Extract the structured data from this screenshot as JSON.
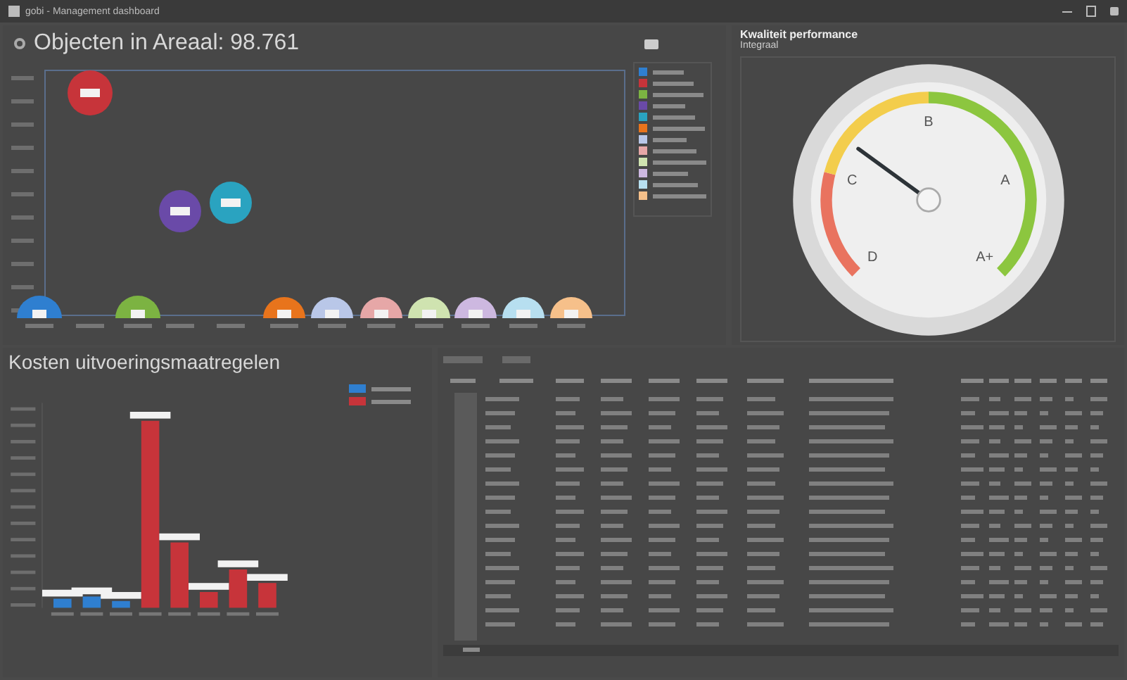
{
  "window": {
    "title": "gobi - Management dashboard"
  },
  "objects_panel": {
    "title": "Objecten in Areaal: 98.761",
    "legend": [
      {
        "color": "#2f7fd0"
      },
      {
        "color": "#c7343a"
      },
      {
        "color": "#7cb342"
      },
      {
        "color": "#6a4aa8"
      },
      {
        "color": "#2aa3c0"
      },
      {
        "color": "#e8741c"
      },
      {
        "color": "#b9c7e8"
      },
      {
        "color": "#e6a7a7"
      },
      {
        "color": "#cfe3b0"
      },
      {
        "color": "#cdb8e0"
      },
      {
        "color": "#b7dff0"
      },
      {
        "color": "#f6c08a"
      }
    ]
  },
  "quality_panel": {
    "title": "Kwaliteit performance",
    "subtitle": "Integraal",
    "gauge": {
      "level": 0.3,
      "labels": [
        "D",
        "C",
        "B",
        "A",
        "A+"
      ]
    }
  },
  "costs_panel": {
    "title": "Kosten uitvoeringsmaatregelen",
    "legend": [
      {
        "color": "#2f7fd0"
      },
      {
        "color": "#c7343a"
      }
    ]
  }
}
